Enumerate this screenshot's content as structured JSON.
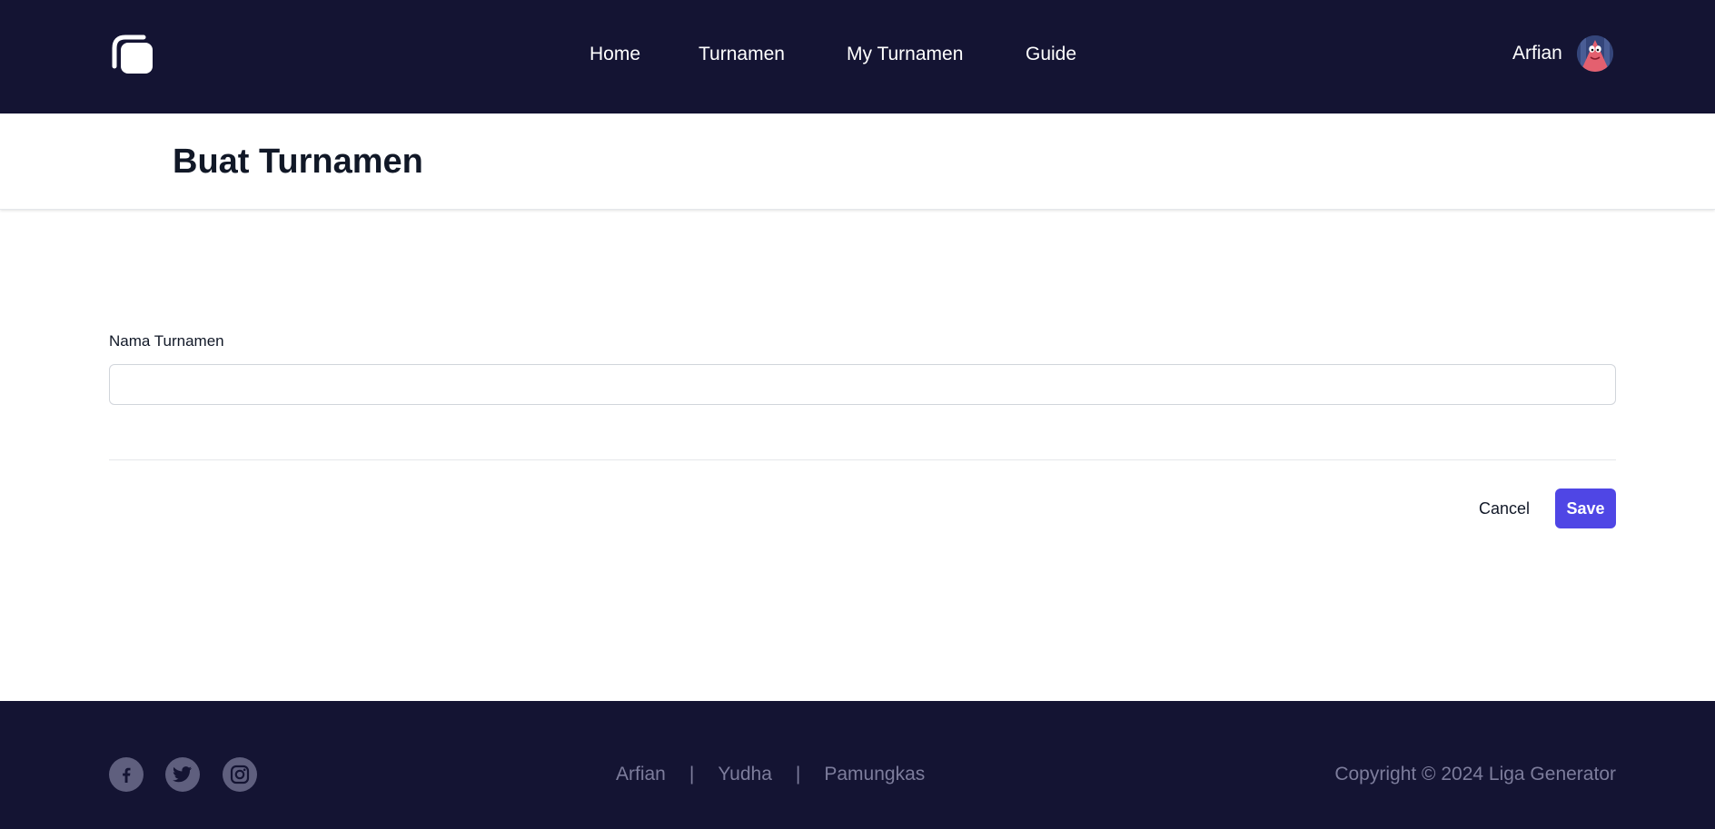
{
  "header": {
    "logo_icon": "rounded-squares-logo-icon",
    "nav": [
      {
        "label": "Home"
      },
      {
        "label": "Turnamen"
      },
      {
        "label": "My Turnamen"
      },
      {
        "label": "Guide"
      }
    ],
    "user": {
      "name": "Arfian",
      "avatar_icon": "cartoon-starfish-avatar"
    }
  },
  "page": {
    "title": "Buat Turnamen"
  },
  "form": {
    "name_label": "Nama Turnamen",
    "name_value": "",
    "name_placeholder": "",
    "cancel_label": "Cancel",
    "save_label": "Save"
  },
  "footer": {
    "social_icons": [
      "facebook-icon",
      "twitter-icon",
      "instagram-icon"
    ],
    "links": [
      "Arfian",
      "Yudha",
      "Pamungkas"
    ],
    "separator": "|",
    "copyright": "Copyright © 2024 Liga Generator"
  },
  "colors": {
    "header_bg": "#141433",
    "accent": "#4f46e5",
    "footer_text": "#7d7d9c"
  }
}
